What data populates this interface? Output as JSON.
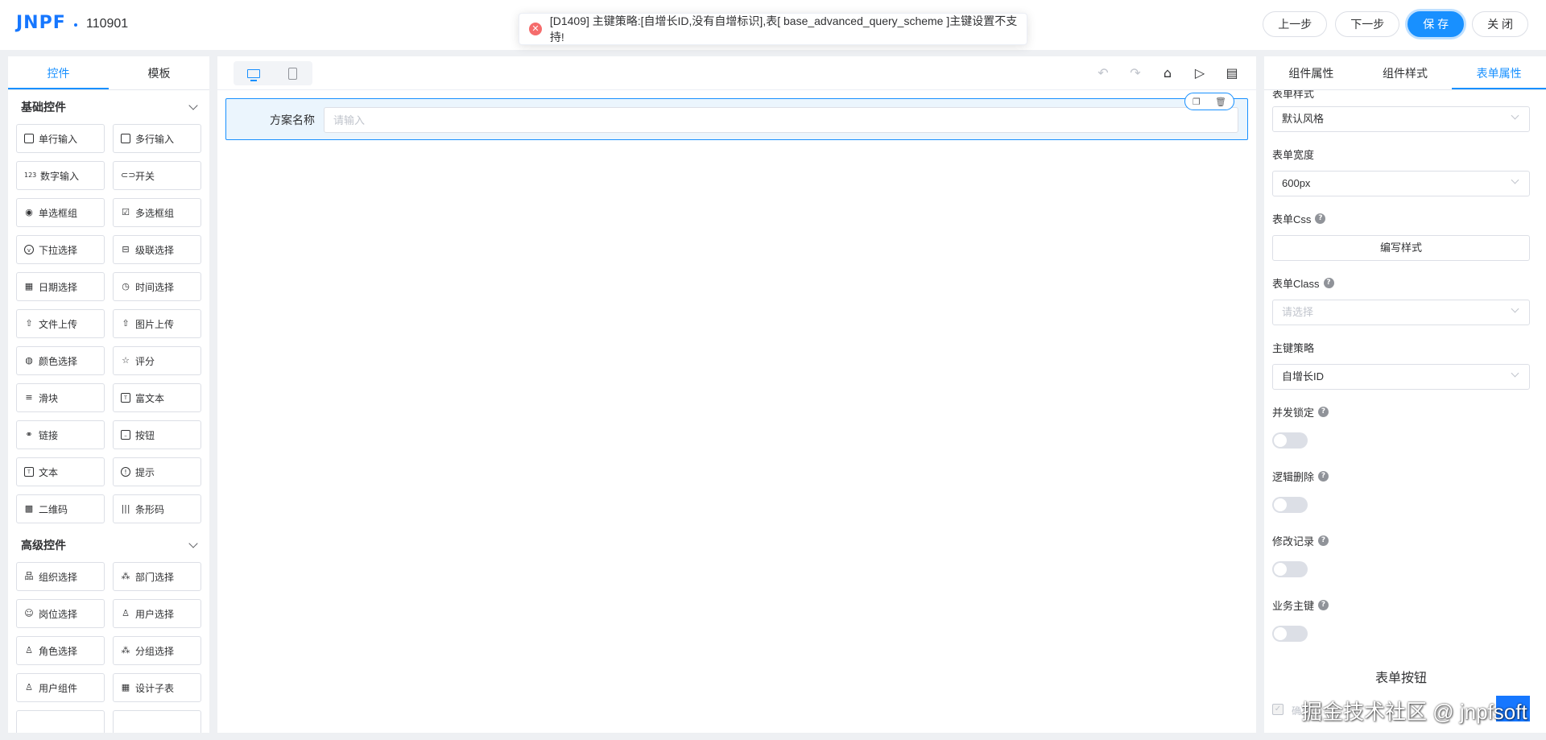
{
  "header": {
    "logo_text": "JNPF",
    "form_code": "110901",
    "buttons": {
      "prev": "上一步",
      "next": "下一步",
      "save": "保 存",
      "close": "关 闭"
    }
  },
  "toast": {
    "type": "error",
    "message": "[D1409] 主键策略:[自增长ID,没有自增标识],表[ base_advanced_query_scheme ]主键设置不支持!"
  },
  "left_panel": {
    "tabs": [
      "控件",
      "模板"
    ],
    "active_tab": "控件",
    "groups": [
      {
        "title": "基础控件",
        "items": [
          {
            "label": "单行输入",
            "icon": "input-icon"
          },
          {
            "label": "多行输入",
            "icon": "textarea-icon"
          },
          {
            "label": "数字输入",
            "icon": "number-icon"
          },
          {
            "label": "开关",
            "icon": "switch-icon"
          },
          {
            "label": "单选框组",
            "icon": "radio-icon"
          },
          {
            "label": "多选框组",
            "icon": "checkbox-icon"
          },
          {
            "label": "下拉选择",
            "icon": "select-icon"
          },
          {
            "label": "级联选择",
            "icon": "cascader-icon"
          },
          {
            "label": "日期选择",
            "icon": "calendar-icon"
          },
          {
            "label": "时间选择",
            "icon": "clock-icon"
          },
          {
            "label": "文件上传",
            "icon": "upload-icon"
          },
          {
            "label": "图片上传",
            "icon": "image-upload-icon"
          },
          {
            "label": "颜色选择",
            "icon": "palette-icon"
          },
          {
            "label": "评分",
            "icon": "star-icon"
          },
          {
            "label": "滑块",
            "icon": "slider-icon"
          },
          {
            "label": "富文本",
            "icon": "richtext-icon"
          },
          {
            "label": "链接",
            "icon": "link-icon"
          },
          {
            "label": "按钮",
            "icon": "button-icon"
          },
          {
            "label": "文本",
            "icon": "text-icon"
          },
          {
            "label": "提示",
            "icon": "alert-icon"
          },
          {
            "label": "二维码",
            "icon": "qrcode-icon"
          },
          {
            "label": "条形码",
            "icon": "barcode-icon"
          }
        ]
      },
      {
        "title": "高级控件",
        "items": [
          {
            "label": "组织选择",
            "icon": "org-icon"
          },
          {
            "label": "部门选择",
            "icon": "dept-icon"
          },
          {
            "label": "岗位选择",
            "icon": "position-icon"
          },
          {
            "label": "用户选择",
            "icon": "user-icon"
          },
          {
            "label": "角色选择",
            "icon": "role-icon"
          },
          {
            "label": "分组选择",
            "icon": "group-icon"
          },
          {
            "label": "用户组件",
            "icon": "user-comp-icon"
          },
          {
            "label": "设计子表",
            "icon": "table-icon"
          }
        ]
      }
    ]
  },
  "canvas": {
    "field": {
      "label": "方案名称",
      "placeholder": "请输入"
    }
  },
  "right_panel": {
    "tabs": [
      "组件属性",
      "组件样式",
      "表单属性"
    ],
    "active_tab": "表单属性",
    "props": {
      "form_style_label": "表单样式",
      "form_style_value": "默认风格",
      "form_width_label": "表单宽度",
      "form_width_value": "600px",
      "form_css_label": "表单Css",
      "form_css_button": "编写样式",
      "form_class_label": "表单Class",
      "form_class_placeholder": "请选择",
      "pk_strategy_label": "主键策略",
      "pk_strategy_value": "自增长ID",
      "concurrency_lock_label": "并发锁定",
      "concurrency_lock": false,
      "logic_delete_label": "逻辑删除",
      "logic_delete": false,
      "change_log_label": "修改记录",
      "change_log": false,
      "biz_pk_label": "业务主键",
      "biz_pk": false,
      "form_buttons_title": "表单按钮",
      "confirm_label": "确定"
    }
  },
  "watermark": "掘金技术社区 @ jnpfsoft",
  "colors": {
    "primary": "#1890ff",
    "error": "#f56c6c"
  }
}
